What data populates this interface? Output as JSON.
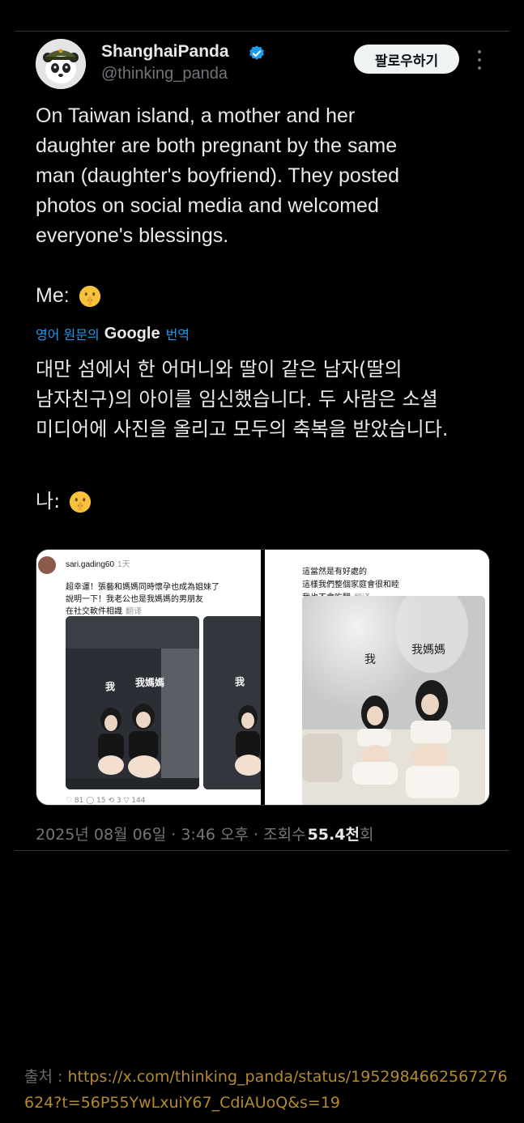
{
  "author": {
    "name": "ShanghaiPanda",
    "handle": "@thinking_panda",
    "verified": true,
    "follow_label": "팔로우하기"
  },
  "tweet": {
    "text": "On Taiwan island, a mother and her\ndaughter are both pregnant by the same\nman (daughter's boyfriend). They posted\nphotos on social media and welcomed\neveryone's blessings.",
    "me_label": "Me:",
    "emoji": "shushing-face",
    "translate_prefix": "영어 원문의",
    "translate_brand": "Google",
    "translate_suffix": "번역",
    "translated_text": "대만 섬에서 한 어머니와 딸이 같은 남자(딸의\n남자친구)의 아이를 임신했습니다. 두 사람은 소셜\n미디어에 사진을 올리고 모두의 축복을 받았습니다.",
    "translated_me": "나:"
  },
  "media": {
    "left": {
      "username": "sari.gading60",
      "time": "1天",
      "caption": "超幸運！張藝和媽媽同時懷孕也成為姐妹了\n說明一下！我老公也是我媽媽的男朋友\n在社交軟件相識",
      "translate": "翻译",
      "label_me": "我",
      "label_mom": "我媽媽",
      "stats": "♡ 81   ◯ 15   ⟲ 3   ▽ 144"
    },
    "right": {
      "caption": "這當然是有好處的\n這樣我們整個家庭會很和睦\n我也不會吃醋",
      "translate": "翻译",
      "label_me": "我",
      "label_mom": "我媽媽"
    }
  },
  "meta": {
    "date": "2025년 08월 06일 · 3:46 오후 · 조회수",
    "views": "55.4천",
    "views_suffix": "회"
  },
  "source": {
    "label": "출처 :",
    "url": "https://x.com/thinking_panda/status/1952984662567276624?t=56P55YwLxuiY67_CdiAUoQ&s=19"
  },
  "colors": {
    "background": "#000000",
    "link": "#1d9bf0",
    "muted": "#71767b",
    "verified": "#1d9bf0",
    "source_url": "#b38a2e"
  }
}
